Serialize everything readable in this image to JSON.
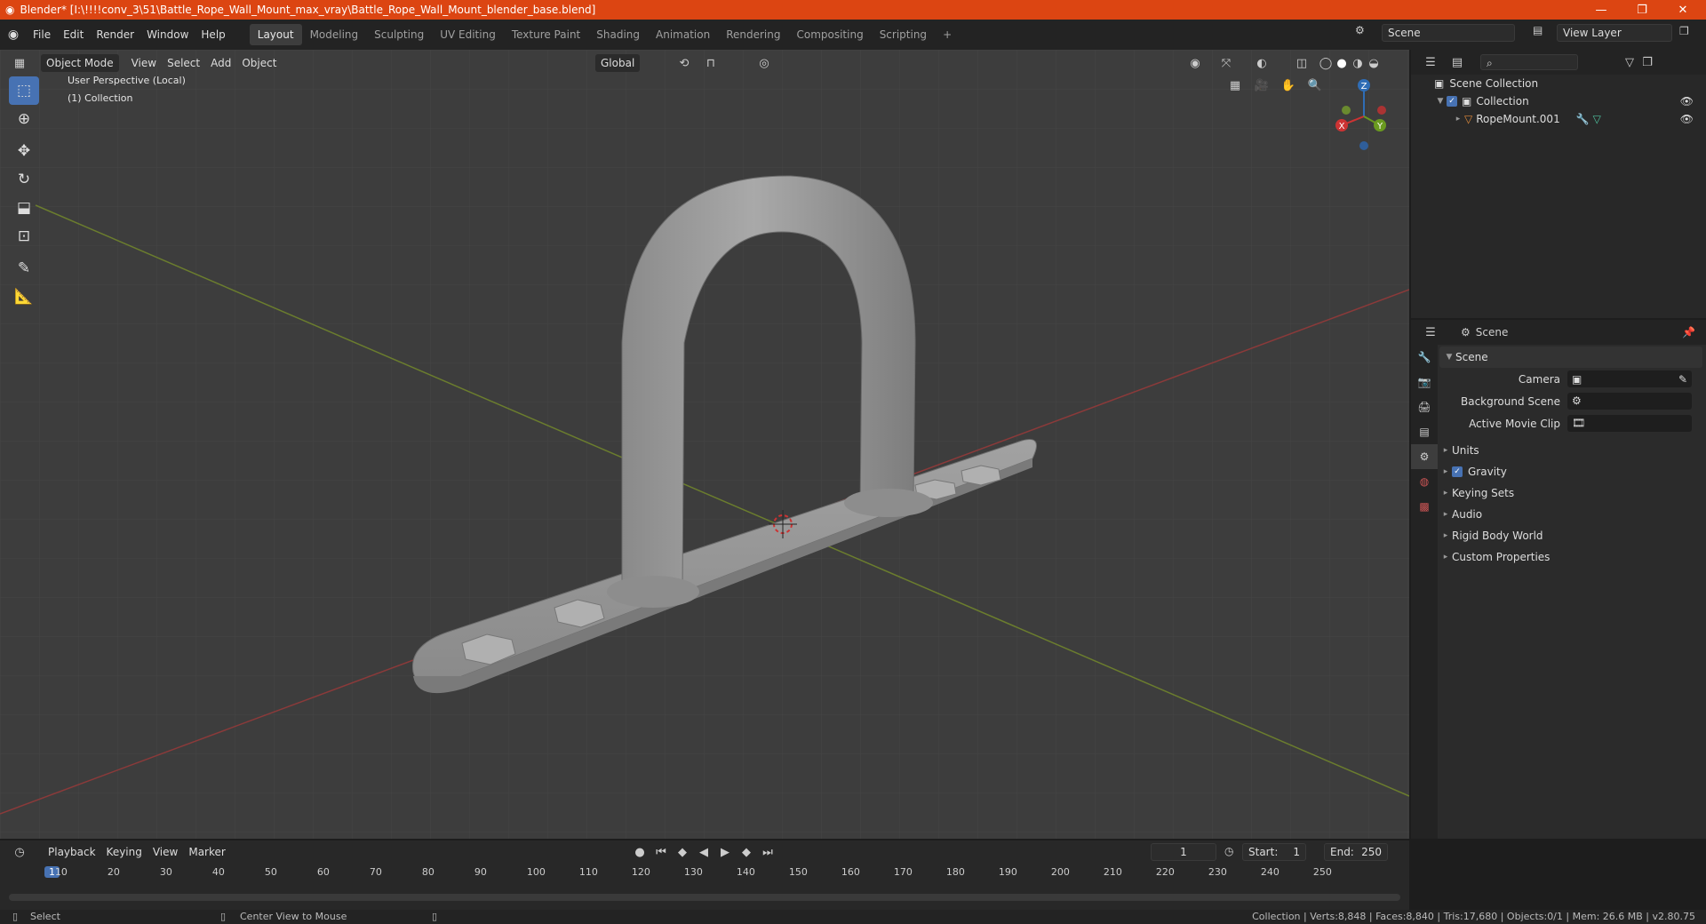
{
  "title": "Blender* [I:\\!!!!conv_3\\51\\Battle_Rope_Wall_Mount_max_vray\\Battle_Rope_Wall_Mount_blender_base.blend]",
  "window_controls": {
    "minimize": "—",
    "maximize": "❐",
    "close": "✕"
  },
  "menus": [
    "File",
    "Edit",
    "Render",
    "Window",
    "Help"
  ],
  "workspaces": [
    "Layout",
    "Modeling",
    "Sculpting",
    "UV Editing",
    "Texture Paint",
    "Shading",
    "Animation",
    "Rendering",
    "Compositing",
    "Scripting"
  ],
  "add_tab": "+",
  "scene_name": "Scene",
  "view_layer": "View Layer",
  "viewport": {
    "mode": "Object Mode",
    "menus": [
      "View",
      "Select",
      "Add",
      "Object"
    ],
    "orientation": "Global",
    "overlay_line1": "User Perspective (Local)",
    "overlay_line2": "(1) Collection",
    "gizmo": {
      "x": "X",
      "y": "Y",
      "z": "Z"
    }
  },
  "tools": [
    "select-box",
    "cursor",
    "move",
    "rotate",
    "scale",
    "transform",
    "annotate",
    "measure"
  ],
  "outliner": {
    "root": "Scene Collection",
    "collection": "Collection",
    "object": "RopeMount.001"
  },
  "properties": {
    "header": "Scene",
    "panel": "Scene",
    "fields": [
      {
        "label": "Camera"
      },
      {
        "label": "Background Scene"
      },
      {
        "label": "Active Movie Clip"
      }
    ],
    "sections": [
      {
        "label": "Units",
        "checkbox": false
      },
      {
        "label": "Gravity",
        "checkbox": true
      },
      {
        "label": "Keying Sets",
        "checkbox": false
      },
      {
        "label": "Audio",
        "checkbox": false
      },
      {
        "label": "Rigid Body World",
        "checkbox": false
      },
      {
        "label": "Custom Properties",
        "checkbox": false
      }
    ]
  },
  "timeline": {
    "menus": [
      "Playback",
      "Keying",
      "View",
      "Marker"
    ],
    "current_frame": "1",
    "start_label": "Start:",
    "start": "1",
    "end_label": "End:",
    "end": "250",
    "ruler": [
      "1",
      "10",
      "20",
      "30",
      "40",
      "50",
      "60",
      "70",
      "80",
      "90",
      "100",
      "110",
      "120",
      "130",
      "140",
      "150",
      "160",
      "170",
      "180",
      "190",
      "200",
      "210",
      "220",
      "230",
      "240",
      "250"
    ]
  },
  "status": {
    "left1": "Select",
    "left2": "Center View to Mouse",
    "right": "Collection | Verts:8,848 | Faces:8,840 | Tris:17,680 | Objects:0/1 | Mem: 26.6 MB | v2.80.75"
  },
  "colors": {
    "title_bar": "#dc4512",
    "accent": "#4772b3",
    "viewport_bg": "#3d3d3d"
  }
}
